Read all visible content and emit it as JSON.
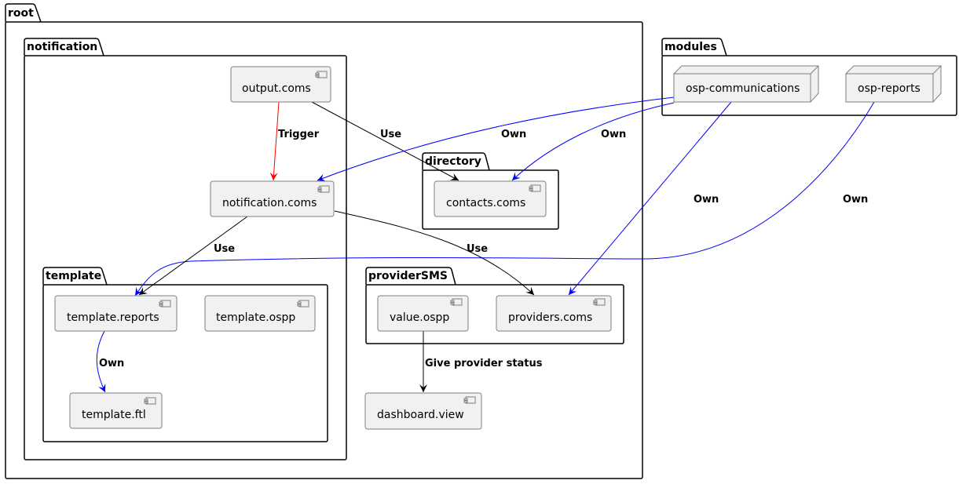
{
  "diagram": {
    "type": "component",
    "packages": [
      {
        "id": "root",
        "title": "root"
      },
      {
        "id": "notification",
        "title": "notification"
      },
      {
        "id": "template",
        "title": "template"
      },
      {
        "id": "directory",
        "title": "directory"
      },
      {
        "id": "providerSMS",
        "title": "providerSMS"
      },
      {
        "id": "modules",
        "title": "modules"
      }
    ],
    "components": [
      {
        "id": "output_coms",
        "label": "output.coms",
        "package": "notification",
        "kind": "component"
      },
      {
        "id": "notification_coms",
        "label": "notification.coms",
        "package": "notification",
        "kind": "component"
      },
      {
        "id": "template_reports",
        "label": "template.reports",
        "package": "template",
        "kind": "component"
      },
      {
        "id": "template_ospp",
        "label": "template.ospp",
        "package": "template",
        "kind": "component"
      },
      {
        "id": "template_ftl",
        "label": "template.ftl",
        "package": "template",
        "kind": "component"
      },
      {
        "id": "contacts_coms",
        "label": "contacts.coms",
        "package": "directory",
        "kind": "component"
      },
      {
        "id": "value_ospp",
        "label": "value.ospp",
        "package": "providerSMS",
        "kind": "component"
      },
      {
        "id": "providers_coms",
        "label": "providers.coms",
        "package": "providerSMS",
        "kind": "component"
      },
      {
        "id": "dashboard_view",
        "label": "dashboard.view",
        "package": "root",
        "kind": "component"
      },
      {
        "id": "osp_communications",
        "label": "osp-communications",
        "package": "modules",
        "kind": "node"
      },
      {
        "id": "osp_reports",
        "label": "osp-reports",
        "package": "modules",
        "kind": "node"
      }
    ],
    "edges": [
      {
        "from": "output_coms",
        "to": "notification_coms",
        "label": "Trigger",
        "color": "#ff0000"
      },
      {
        "from": "output_coms",
        "to": "contacts_coms",
        "label": "Use",
        "color": "#000000"
      },
      {
        "from": "osp_communications",
        "to": "notification_coms",
        "label": "Own",
        "color": "#0000ff"
      },
      {
        "from": "osp_communications",
        "to": "contacts_coms",
        "label": "Own",
        "color": "#0000ff"
      },
      {
        "from": "osp_communications",
        "to": "providers_coms",
        "label": "Own",
        "color": "#0000ff"
      },
      {
        "from": "osp_reports",
        "to": "template_reports",
        "label": "Own",
        "color": "#0000ff"
      },
      {
        "from": "notification_coms",
        "to": "template_reports",
        "label": "Use",
        "color": "#000000"
      },
      {
        "from": "notification_coms",
        "to": "providers_coms",
        "label": "Use",
        "color": "#000000"
      },
      {
        "from": "template_reports",
        "to": "template_ftl",
        "label": "Own",
        "color": "#0000ff"
      },
      {
        "from": "value_ospp",
        "to": "dashboard_view",
        "label": "Give provider status",
        "color": "#000000"
      }
    ]
  },
  "colors": {
    "component_fill": "#f1f1f1",
    "component_border": "#7f7f7f",
    "own_edge": "#0000ff",
    "trigger_edge": "#ff0000",
    "use_edge": "#000000"
  }
}
